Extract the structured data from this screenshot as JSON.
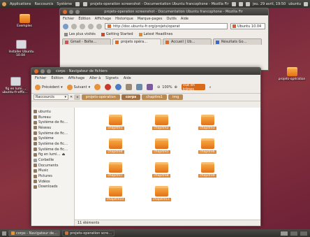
{
  "top_panel": {
    "menus": [
      "Applications",
      "Raccourcis",
      "Système"
    ],
    "window_title": "projets-operation screenshot - Documentation Ubuntu francophone - Mozilla Fir",
    "clock": "jeu. 29 avril, 19:50",
    "user": "ubuntu"
  },
  "desktop": {
    "icons": [
      {
        "label": "Exemples",
        "kind": "folder"
      },
      {
        "label": "Installer Ubuntu 10.04",
        "kind": "doc"
      },
      {
        "label": "fig en lumi…, ubuntu-fr-offic…",
        "kind": "doc"
      },
      {
        "label": "projets-opération",
        "kind": "folder"
      }
    ]
  },
  "browser": {
    "menu": [
      "Fichier",
      "Édition",
      "Affichage",
      "Historique",
      "Marque-pages",
      "Outils",
      "Aide"
    ],
    "url": "http://doc.ubuntu-fr.org/projets/operat",
    "search": "Ubuntu 10.04",
    "bookmarks": [
      "Les plus visités",
      "Getting Started",
      "Latest Headlines"
    ],
    "tabs": [
      "Gmail - Boîte…",
      "projets opéra…",
      "Accueil | Ub…",
      "Résultats Go…"
    ]
  },
  "file_manager": {
    "title": "corps - Navigateur de fichiers",
    "menu": [
      "Fichier",
      "Édition",
      "Affichage",
      "Aller à",
      "Signets",
      "Aide"
    ],
    "toolbar": {
      "back": "Précédent",
      "forward": "Suivant",
      "zoom": "100%",
      "view": "Vue en icônes"
    },
    "places_label": "Raccourcis",
    "breadcrumbs": [
      "projets-opération",
      "corps",
      "chapitre1",
      "img"
    ],
    "sidebar": [
      "ubuntu",
      "Bureau",
      "Système de fic…",
      "Réseau",
      "Système de fic…",
      "Système",
      "Système de fic…",
      "Système de fic…",
      "fig en lumi…",
      "Corbeille",
      "Documents",
      "Music",
      "Pictures",
      "Vidéos",
      "Downloads"
    ],
    "folders": [
      "chapitre1",
      "chapitre2",
      "chapitre3",
      "chapitre4",
      "chapitre5",
      "chapitre6",
      "chapitre7",
      "chapitre8",
      "chapitre9",
      "chapitre10",
      "chapitre11"
    ],
    "status": "11 éléments"
  },
  "bottom_panel": {
    "tasks": [
      "corps - Navigateur de…",
      "projets-operation scre…"
    ]
  }
}
